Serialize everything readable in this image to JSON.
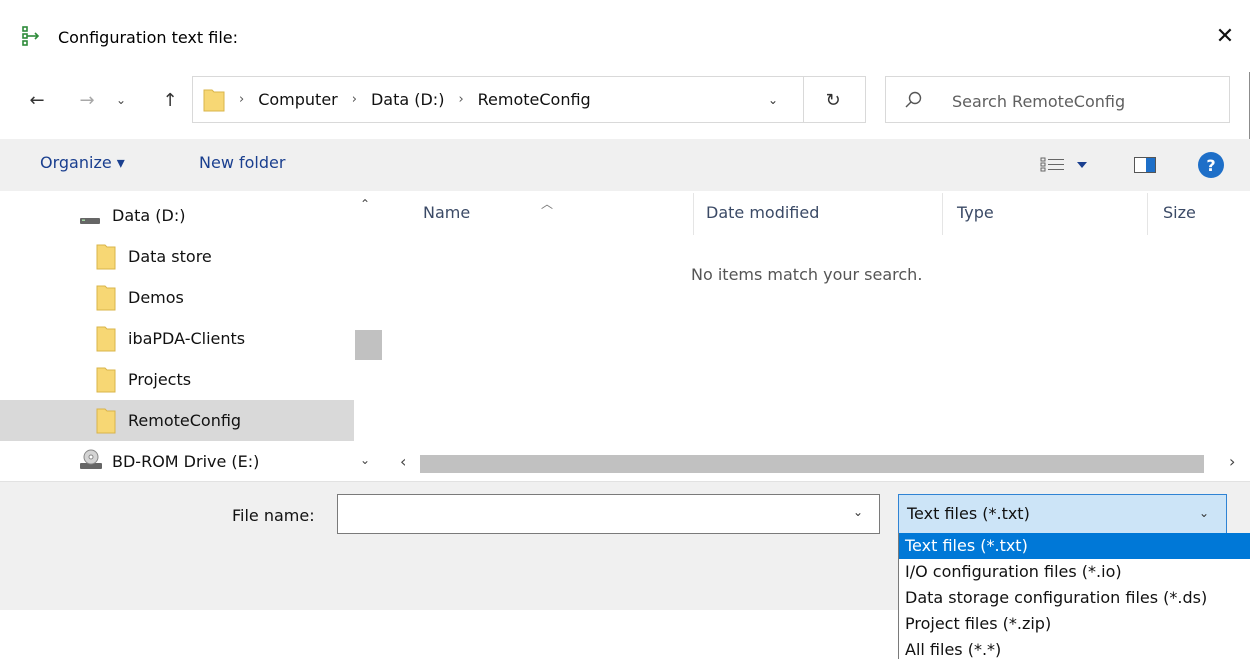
{
  "window": {
    "title": "Configuration text file:",
    "close_label": "✕"
  },
  "nav": {
    "back_label": "←",
    "forward_label": "→",
    "recent_label": "⌄",
    "up_label": "↑"
  },
  "address": {
    "crumbs": [
      "Computer",
      "Data (D:)",
      "RemoteConfig"
    ],
    "separator": "›",
    "dropdown_label": "⌄",
    "refresh_label": "↻"
  },
  "search": {
    "placeholder": "Search RemoteConfig"
  },
  "toolbar": {
    "organize_label": "Organize ▾",
    "new_folder_label": "New folder",
    "help_label": "?"
  },
  "navpane": {
    "items": [
      {
        "label": "Data (D:)",
        "icon": "drive-icon",
        "selected": false
      },
      {
        "label": "Data store",
        "icon": "folder-icon",
        "selected": false
      },
      {
        "label": "Demos",
        "icon": "folder-icon",
        "selected": false
      },
      {
        "label": "ibaPDA-Clients",
        "icon": "folder-icon",
        "selected": false
      },
      {
        "label": "Projects",
        "icon": "folder-icon",
        "selected": false
      },
      {
        "label": "RemoteConfig",
        "icon": "folder-icon",
        "selected": true
      },
      {
        "label": "BD-ROM Drive (E:)",
        "icon": "optical-drive-icon",
        "selected": false
      }
    ]
  },
  "filelist": {
    "columns": [
      "Name",
      "Date modified",
      "Type",
      "Size"
    ],
    "empty_message": "No items match your search."
  },
  "bottom": {
    "filename_label": "File name:",
    "filename_value": "",
    "filetype_selected": "Text files (*.txt)",
    "filetype_options": [
      "Text files (*.txt)",
      "I/O configuration files (*.io)",
      "Data storage configuration files (*.ds)",
      "Project files (*.zip)",
      "All files (*.*)"
    ]
  },
  "colors": {
    "accent": "#0078d7",
    "selection_bg": "#cce4f7",
    "toolbar_bg": "#f0f0f0",
    "link_text": "#1a3f8f"
  }
}
